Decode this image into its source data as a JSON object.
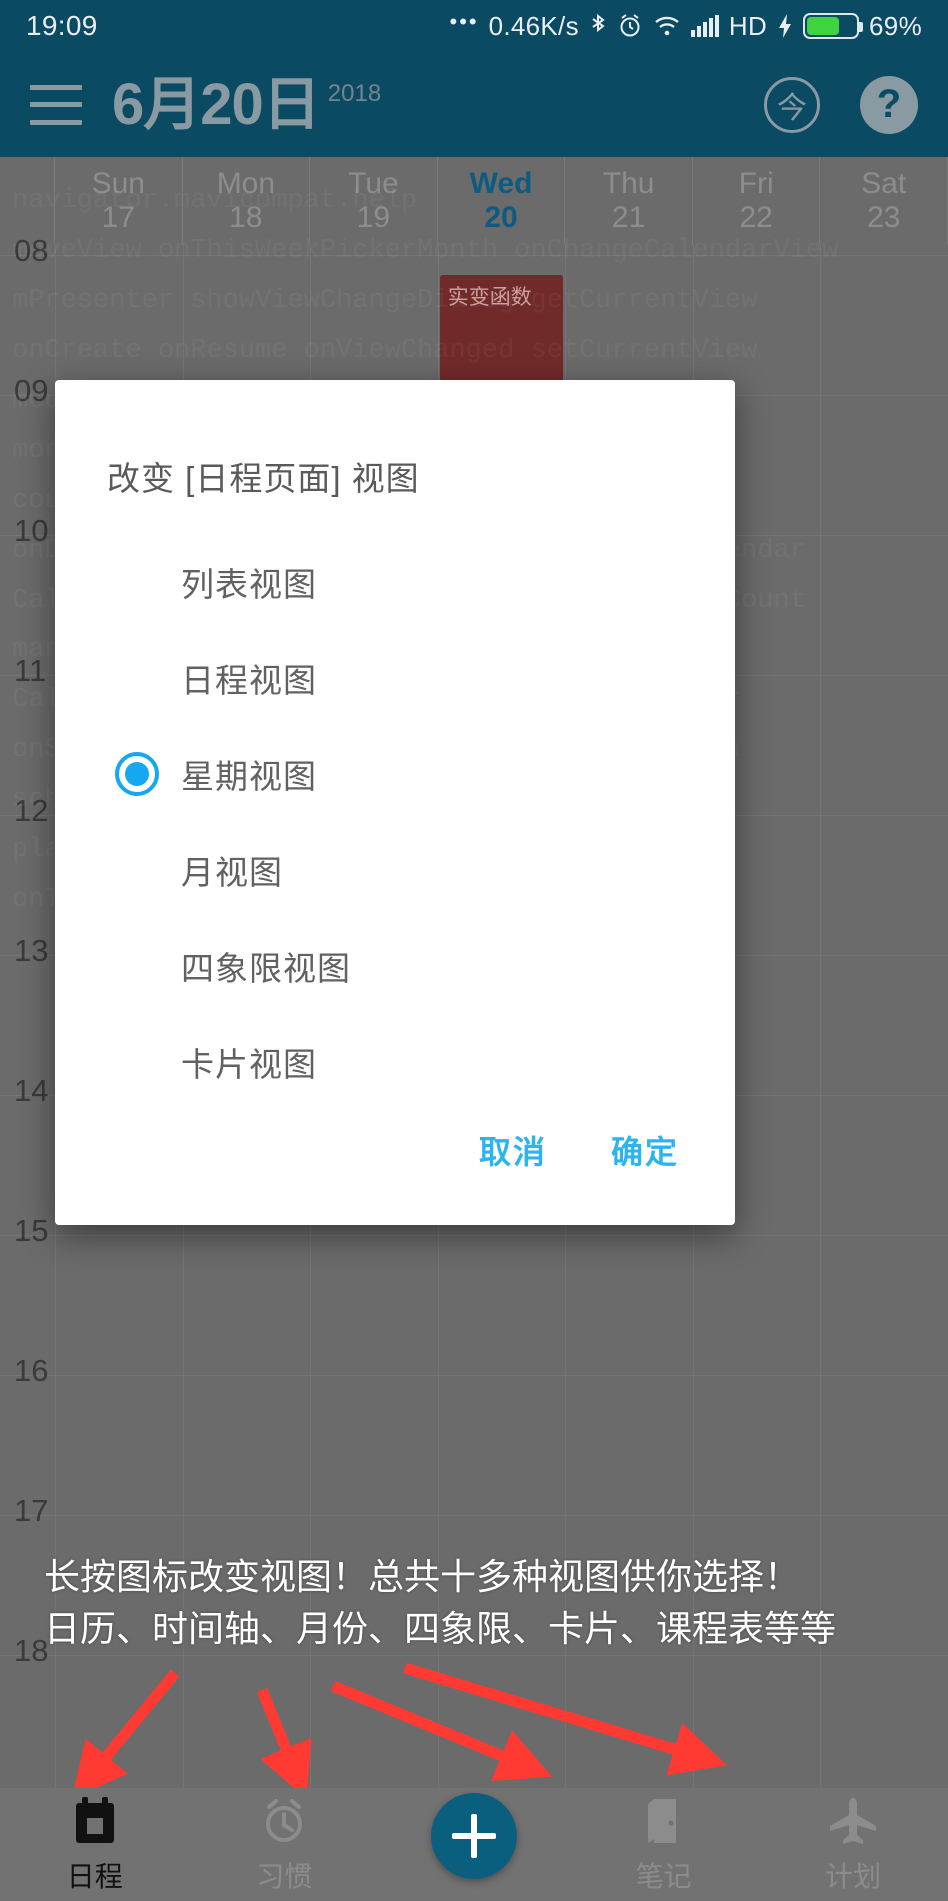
{
  "status_bar": {
    "time": "19:09",
    "network_speed": "0.46K/s",
    "dots": "•••",
    "bluetooth_icon": "bluetooth-icon",
    "alarm_icon": "alarm-icon",
    "wifi_icon": "wifi-icon",
    "signal_icon": "signal-icon",
    "network_type": "HD",
    "charging_icon": "charging-bolt-icon",
    "battery_percent": "69%"
  },
  "app_bar": {
    "menu_icon": "hamburger-menu-icon",
    "title": "6月20日",
    "year": "2018",
    "today_button": "今",
    "help_button": "?"
  },
  "calendar": {
    "days": [
      {
        "dow": "Sun",
        "num": "17",
        "today": false
      },
      {
        "dow": "Mon",
        "num": "18",
        "today": false
      },
      {
        "dow": "Tue",
        "num": "19",
        "today": false
      },
      {
        "dow": "Wed",
        "num": "20",
        "today": true
      },
      {
        "dow": "Thu",
        "num": "21",
        "today": false
      },
      {
        "dow": "Fri",
        "num": "22",
        "today": false
      },
      {
        "dow": "Sat",
        "num": "23",
        "today": false
      }
    ],
    "hours": [
      "08",
      "09",
      "10",
      "11",
      "12",
      "13",
      "14",
      "15",
      "16",
      "17",
      "18"
    ],
    "event": {
      "title": "实变函数",
      "color": "#712a2a"
    },
    "today_color": "#0d5b80",
    "watermark_text": "navigator.mavicompat.help\nmoveView onThisWeekPickerMonth onChangeCalendarView\nmPresenter showViewChangeDialog getCurrentView\nonCreate onResume onViewChanged setCurrentView\nmCurrentView listView scheduleView weekView\nmonthView quadrantView cardView timelineView\ncourseTableView onSelectedChangedCallback\nonDialogPositiveClick setViewMode refreshCalendar\nCalendarViewManager.findView adapter.getItemCount\nmanager.findViewById adapter.getItemViewType\nCalendarViewManager.findView updateWeekHeader\nonSaveInstanceState restoreViewState bindData\nscheduleFragment habitFragment noteFragment\nplanFragment mainActivity bottomNavigation\nonTabSelected onLongClickListener showDialog"
  },
  "dialog": {
    "title": "改变 [日程页面] 视图",
    "options": [
      {
        "label": "列表视图",
        "selected": false
      },
      {
        "label": "日程视图",
        "selected": false
      },
      {
        "label": "星期视图",
        "selected": true
      },
      {
        "label": "月视图",
        "selected": false
      },
      {
        "label": "四象限视图",
        "selected": false
      },
      {
        "label": "卡片视图",
        "selected": false
      }
    ],
    "cancel_label": "取消",
    "confirm_label": "确定",
    "accent_color": "#2cb4f0",
    "radio_color": "#15a7ef"
  },
  "annotation": {
    "text": "长按图标改变视图！总共十多种视图供你选择！\n日历、时间轴、月份、四象限、卡片、课程表等等",
    "arrow_color": "#ff3a32"
  },
  "bottom_nav": {
    "items": [
      {
        "label": "日程",
        "icon": "calendar-icon",
        "active": true
      },
      {
        "label": "习惯",
        "icon": "alarm-clock-icon",
        "active": false
      },
      {
        "label": "笔记",
        "icon": "notebook-icon",
        "active": false
      },
      {
        "label": "计划",
        "icon": "airplane-icon",
        "active": false
      }
    ],
    "fab_icon": "plus-icon"
  }
}
